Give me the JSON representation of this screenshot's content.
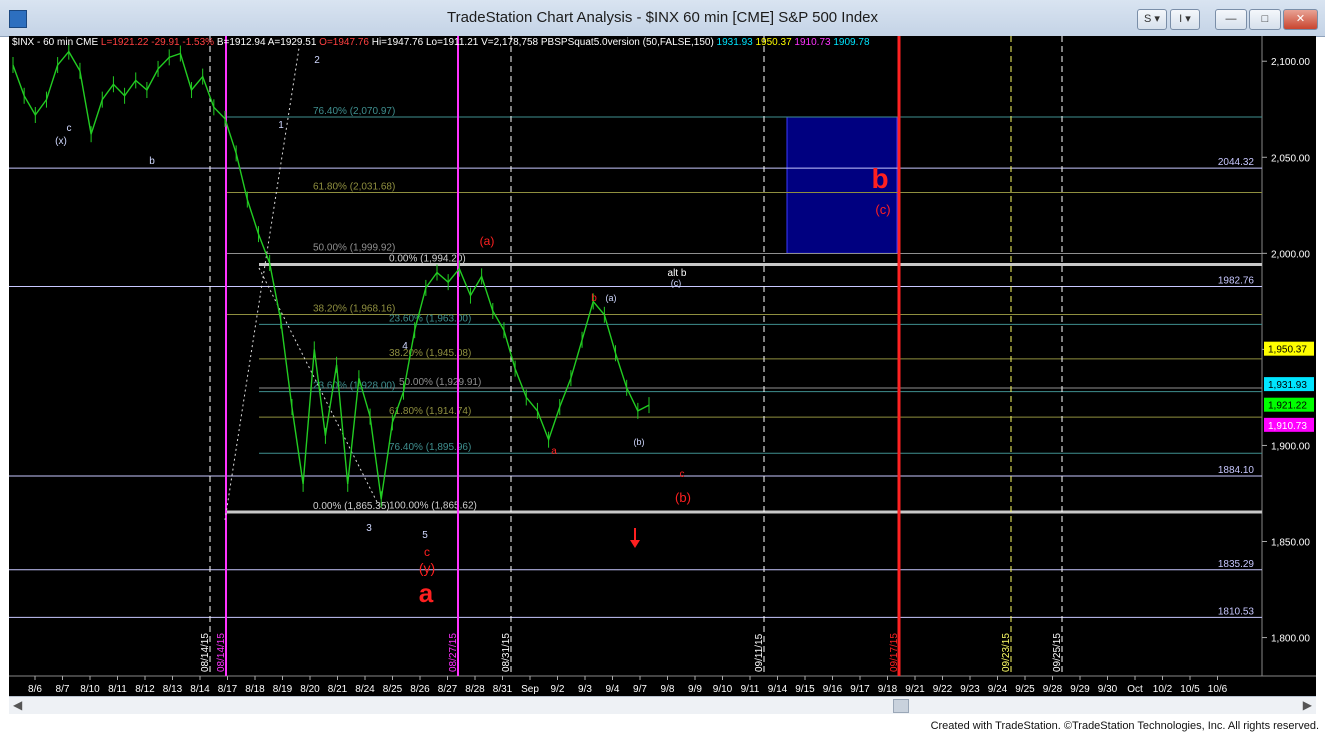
{
  "window": {
    "title": "TradeStation Chart Analysis - $INX 60 min [CME] S&P 500 Index",
    "controls": {
      "s_label": "S",
      "i_label": "I",
      "min": "—",
      "max": "□",
      "close": "✕"
    }
  },
  "header": {
    "symbol": "$INX - 60 min",
    "exchange": "CME",
    "last": "L=1921.22",
    "change": "-29.91",
    "pct": "-1.53%",
    "bid": "B=1912.94",
    "ask": "A=1929.51",
    "open": "O=1947.76",
    "high": "Hi=1947.76",
    "low": "Lo=1911.21",
    "volume": "V=2,178,758",
    "study": "PBSPSquat5.0version (50,FALSE,150)",
    "s1": "1931.93",
    "s2": "1950.37",
    "s3": "1910.73",
    "s4": "1909.78"
  },
  "chart_data": {
    "type": "line",
    "title": "",
    "ylim": [
      1780,
      2110
    ],
    "y_ticks": [
      {
        "v": 2100,
        "label": "2,100.00"
      },
      {
        "v": 2050,
        "label": "2,050.00"
      },
      {
        "v": 2000,
        "label": "2,000.00"
      },
      {
        "v": 1950,
        "label": "1,950.00"
      },
      {
        "v": 1900,
        "label": "1,900.00"
      },
      {
        "v": 1850,
        "label": "1,850.00"
      },
      {
        "v": 1800,
        "label": "1,800.00"
      }
    ],
    "x_labels": [
      "8/6",
      "8/7",
      "8/10",
      "8/11",
      "8/12",
      "8/13",
      "8/14",
      "8/17",
      "8/18",
      "8/19",
      "8/20",
      "8/21",
      "8/24",
      "8/25",
      "8/26",
      "8/27",
      "8/28",
      "8/31",
      "Sep",
      "9/2",
      "9/3",
      "9/4",
      "9/7",
      "9/8",
      "9/9",
      "9/10",
      "9/11",
      "9/14",
      "9/15",
      "9/16",
      "9/17",
      "9/18",
      "9/21",
      "9/22",
      "9/23",
      "9/24",
      "9/25",
      "9/28",
      "9/29",
      "9/30",
      "Oct",
      "10/2",
      "10/5",
      "10/6"
    ],
    "price_series": [
      [
        0,
        2098
      ],
      [
        1,
        2082
      ],
      [
        2,
        2072
      ],
      [
        3,
        2080
      ],
      [
        4,
        2098
      ],
      [
        5,
        2105
      ],
      [
        6,
        2095
      ],
      [
        7,
        2062
      ],
      [
        8,
        2080
      ],
      [
        9,
        2088
      ],
      [
        10,
        2082
      ],
      [
        11,
        2090
      ],
      [
        12,
        2085
      ],
      [
        13,
        2096
      ],
      [
        14,
        2102
      ],
      [
        15,
        2104
      ],
      [
        16,
        2085
      ],
      [
        17,
        2092
      ],
      [
        18,
        2076
      ],
      [
        19,
        2070
      ],
      [
        20,
        2052
      ],
      [
        21,
        2028
      ],
      [
        22,
        2010
      ],
      [
        23,
        1995
      ],
      [
        24,
        1965
      ],
      [
        25,
        1920
      ],
      [
        26,
        1880
      ],
      [
        27,
        1950
      ],
      [
        28,
        1905
      ],
      [
        29,
        1942
      ],
      [
        30,
        1880
      ],
      [
        31,
        1935
      ],
      [
        32,
        1915
      ],
      [
        33,
        1872
      ],
      [
        34,
        1912
      ],
      [
        35,
        1928
      ],
      [
        36,
        1960
      ],
      [
        37,
        1982
      ],
      [
        38,
        1990
      ],
      [
        39,
        1985
      ],
      [
        40,
        1992
      ],
      [
        41,
        1978
      ],
      [
        42,
        1988
      ],
      [
        43,
        1970
      ],
      [
        44,
        1960
      ],
      [
        45,
        1940
      ],
      [
        46,
        1925
      ],
      [
        47,
        1918
      ],
      [
        48,
        1903
      ],
      [
        49,
        1920
      ],
      [
        50,
        1935
      ],
      [
        51,
        1955
      ],
      [
        52,
        1975
      ],
      [
        53,
        1968
      ],
      [
        54,
        1948
      ],
      [
        55,
        1930
      ],
      [
        56,
        1918
      ],
      [
        57,
        1921
      ]
    ],
    "x_points_max": 57,
    "horizontal_levels": [
      {
        "v": 2044.32,
        "label": "2044.32"
      },
      {
        "v": 1982.76,
        "label": "1982.76"
      },
      {
        "v": 1884.1,
        "label": "1884.10"
      },
      {
        "v": 1835.29,
        "label": "1835.29"
      },
      {
        "v": 1810.53,
        "label": "1810.53"
      }
    ],
    "fib_levels": [
      {
        "v": 2070.97,
        "label": "76.40% (2,070.97)",
        "color": "#3f8f8f"
      },
      {
        "v": 2031.68,
        "label": "61.80% (2,031.68)",
        "color": "#8f8f3f"
      },
      {
        "v": 1999.92,
        "label": "50.00% (1,999.92)",
        "color": "#8f8f8f"
      },
      {
        "v": 1994.2,
        "label": "0.00% (1,994.20)",
        "color": "#c8c8c8"
      },
      {
        "v": 1968.16,
        "label": "38.20% (1,968.16)",
        "color": "#8f8f3f"
      },
      {
        "v": 1963.0,
        "label": "23.60% (1,963.00)",
        "color": "#3f8f8f"
      },
      {
        "v": 1945.08,
        "label": "38.20% (1,945.08)",
        "color": "#8f8f3f"
      },
      {
        "v": 1929.91,
        "label": "50.00% (1,929.91)",
        "color": "#8f8f8f"
      },
      {
        "v": 1928.0,
        "label": "23.60% (1,928.00)",
        "color": "#3f8f8f"
      },
      {
        "v": 1914.74,
        "label": "61.80% (1,914.74)",
        "color": "#8f8f3f"
      },
      {
        "v": 1895.96,
        "label": "76.40% (1,895.96)",
        "color": "#3f8f8f"
      },
      {
        "v": 1865.35,
        "label": "0.00% (1,865.35)",
        "color": "#c8c8c8"
      },
      {
        "v": 1865.62,
        "label": "100.00% (1,865.62)",
        "color": "#c8c8c8"
      }
    ],
    "price_tags": [
      {
        "v": 1950.37,
        "label": "1,950.37",
        "color": "#ffff00",
        "text": "#000000"
      },
      {
        "v": 1931.93,
        "label": "1,931.93",
        "color": "#00e5ff",
        "text": "#000000"
      },
      {
        "v": 1921.22,
        "label": "1,921.22",
        "color": "#00ff00",
        "text": "#000000"
      },
      {
        "v": 1910.73,
        "label": "1,910.73",
        "color": "#ff00ff",
        "text": "#ffffff"
      }
    ],
    "vertical_markers": [
      {
        "label": "08/14/15",
        "color": "#ffffff",
        "dash": true
      },
      {
        "label": "08/14/15",
        "color": "#ff33ff",
        "dash": false
      },
      {
        "label": "08/27/15",
        "color": "#ff33ff",
        "dash": false
      },
      {
        "label": "08/31/15",
        "color": "#ffffff",
        "dash": true
      },
      {
        "label": "09/11/15",
        "color": "#ffffff",
        "dash": true
      },
      {
        "label": "09/17/15",
        "color": "#ff2222",
        "dash": false
      },
      {
        "label": "09/23/15",
        "color": "#ffff66",
        "dash": true
      },
      {
        "label": "09/25/15",
        "color": "#ffffff",
        "dash": true
      }
    ],
    "annotations": [
      {
        "text": "(x)",
        "color": "#d0d8ff",
        "size": 10
      },
      {
        "text": "c",
        "color": "#d0d8ff",
        "size": 10
      },
      {
        "text": "b",
        "color": "#d0d8ff",
        "size": 10
      },
      {
        "text": "1",
        "color": "#d0d8ff",
        "size": 10
      },
      {
        "text": "2",
        "color": "#d0d8ff",
        "size": 10
      },
      {
        "text": "3",
        "color": "#d0d8ff",
        "size": 10
      },
      {
        "text": "4",
        "color": "#d0d8ff",
        "size": 10
      },
      {
        "text": "5",
        "color": "#d0d8ff",
        "size": 10
      },
      {
        "text": "c",
        "color": "#ff2020",
        "size": 12
      },
      {
        "text": "(y)",
        "color": "#ff2020",
        "size": 14
      },
      {
        "text": "a",
        "color": "#ff2020",
        "size": 26
      },
      {
        "text": "(a)",
        "color": "#ff2020",
        "size": 12
      },
      {
        "text": "alt b",
        "color": "#ffffff",
        "size": 10
      },
      {
        "text": "(c)",
        "color": "#d0d8ff",
        "size": 9
      },
      {
        "text": "b",
        "color": "#ff2020",
        "size": 10
      },
      {
        "text": "(a)",
        "color": "#d0d8ff",
        "size": 9
      },
      {
        "text": "a",
        "color": "#ff2020",
        "size": 10
      },
      {
        "text": "(b)",
        "color": "#d0d8ff",
        "size": 9
      },
      {
        "text": "c",
        "color": "#ff2020",
        "size": 10
      },
      {
        "text": "(b)",
        "color": "#ff2020",
        "size": 13
      },
      {
        "text": "b",
        "color": "#ff2020",
        "size": 28
      },
      {
        "text": "(c)",
        "color": "#ff2020",
        "size": 13
      }
    ],
    "target_box": {
      "y_top": 2070.97,
      "y_bottom": 2000.0,
      "color": "#000080"
    }
  },
  "footer": {
    "text": "Created with TradeStation. ©TradeStation Technologies, Inc. All rights reserved."
  }
}
